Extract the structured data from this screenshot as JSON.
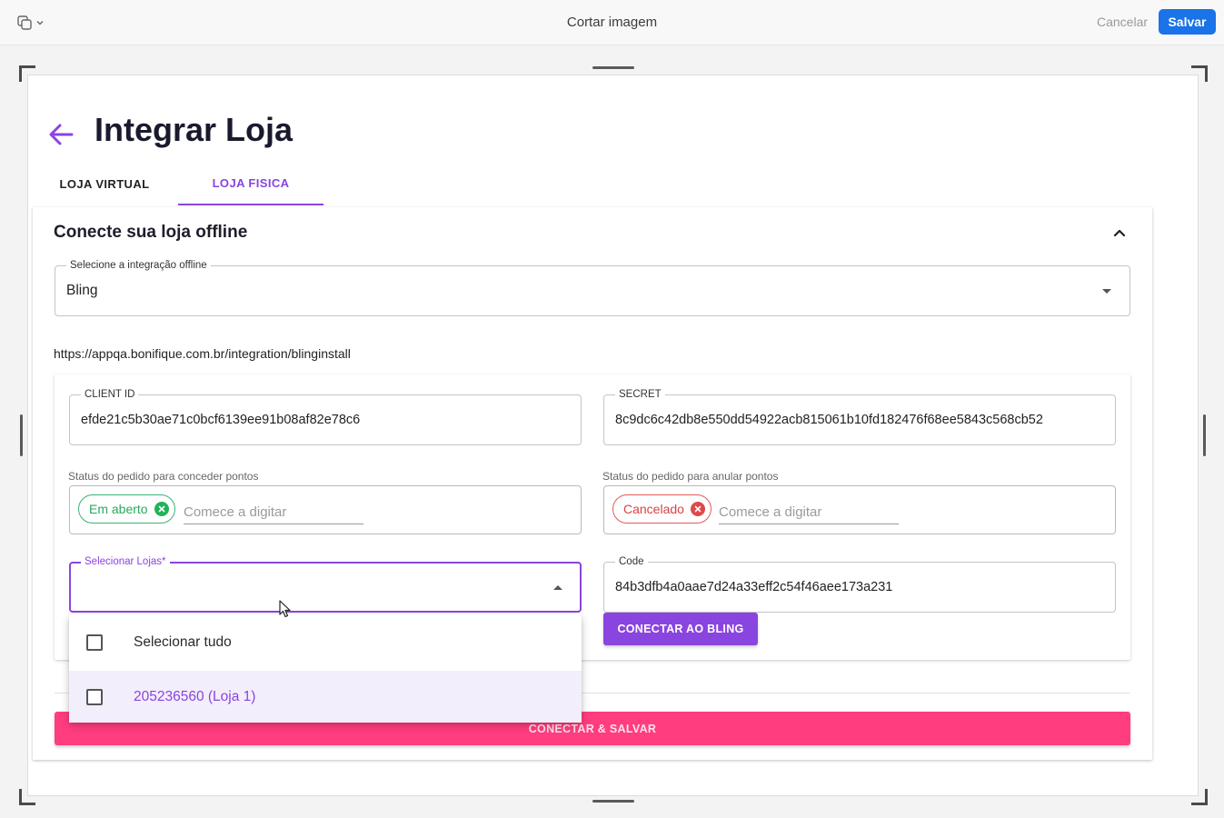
{
  "toolbar": {
    "title": "Cortar imagem",
    "cancel_label": "Cancelar",
    "save_label": "Salvar"
  },
  "page": {
    "title": "Integrar Loja",
    "tabs": [
      {
        "label": "LOJA VIRTUAL",
        "active": false
      },
      {
        "label": "LOJA FISICA",
        "active": true
      }
    ]
  },
  "section": {
    "title": "Conecte sua loja offline",
    "integration_select": {
      "label": "Selecione a integração offline",
      "value": "Bling"
    },
    "integration_url": "https://appqa.bonifique.com.br/integration/blinginstall"
  },
  "form": {
    "client_id": {
      "label": "CLIENT ID",
      "value": "efde21c5b30ae71c0bcf6139ee91b08af82e78c6"
    },
    "secret": {
      "label": "SECRET",
      "value": "8c9dc6c42db8e550dd54922acb815061b10fd182476f68ee5843c568cb52"
    },
    "grant_status": {
      "label": "Status do pedido para conceder pontos",
      "chip": "Em aberto",
      "placeholder": "Comece a digitar"
    },
    "void_status": {
      "label": "Status do pedido para anular pontos",
      "chip": "Cancelado",
      "placeholder": "Comece a digitar"
    },
    "stores_select": {
      "label": "Selecionar Lojas*",
      "value": ""
    },
    "code": {
      "label": "Code",
      "value": "84b3dfb4a0aae7d24a33eff2c54f46aee173a231"
    },
    "connect_bling_label": "CONECTAR AO BLING",
    "connect_save_label": "CONECTAR & SALVAR"
  },
  "stores_dropdown": {
    "options": [
      {
        "label": "Selecionar tudo",
        "checked": false
      },
      {
        "label": "205236560 (Loja 1)",
        "checked": false
      }
    ]
  },
  "colors": {
    "accent": "#8a44e0",
    "primary_pink": "#ff3d7f",
    "save_blue": "#1a73e8",
    "chip_green": "#21b35b",
    "chip_red": "#e04848"
  }
}
